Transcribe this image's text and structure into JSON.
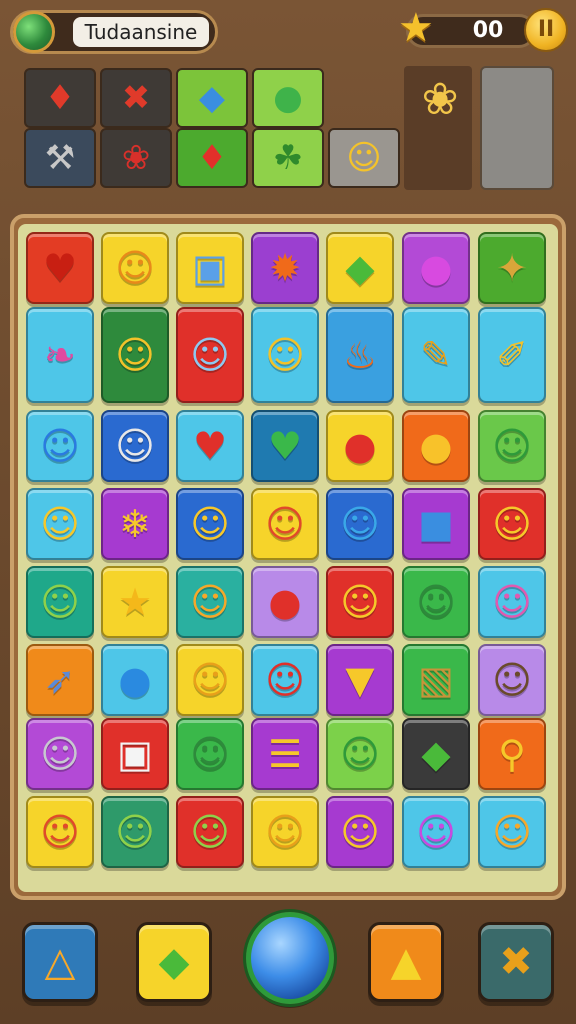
{
  "header": {
    "title": "Tudaansine",
    "score": "00",
    "pause_symbol": "II",
    "star_icon": "star-icon",
    "globe_icon": "globe-icon"
  },
  "collection": [
    {
      "icon": "red-gem-icon",
      "glyph": "♦",
      "bg": "#3f3a36",
      "fg": "#e03a2a"
    },
    {
      "icon": "red-cross-icon",
      "glyph": "✖",
      "bg": "#3f3a36",
      "fg": "#e03a2a"
    },
    {
      "icon": "blue-bird-icon",
      "glyph": "◆",
      "bg": "#7cc43a",
      "fg": "#3a8ee0"
    },
    {
      "icon": "green-creature-icon",
      "glyph": "●",
      "bg": "#8fd14a",
      "fg": "#3fb34a"
    },
    {
      "icon": "wrench-icon",
      "glyph": "⚒",
      "bg": "#3b4a5c",
      "fg": "#c8c8c8"
    },
    {
      "icon": "red-knot-icon",
      "glyph": "❀",
      "bg": "#3f3a36",
      "fg": "#d8302a"
    },
    {
      "icon": "red-diamond-icon",
      "glyph": "♦",
      "bg": "#4caa2e",
      "fg": "#e3302a"
    },
    {
      "icon": "green-dragon-icon",
      "glyph": "☘",
      "bg": "#8fd14a",
      "fg": "#2f8a2c"
    },
    {
      "icon": "yellow-chick-icon",
      "glyph": "☺",
      "bg": "#9a9690",
      "fg": "#f4c32a"
    }
  ],
  "side_icon": "flower-icon",
  "side_glyph": "❀",
  "tiles": [
    {
      "icon": "apple-icon",
      "glyph": "♥",
      "bg": "#e33c24",
      "fg": "#c81f12"
    },
    {
      "icon": "cat-face-icon",
      "glyph": "☺",
      "bg": "#f6d42a",
      "fg": "#e88a1a"
    },
    {
      "icon": "robot-face-icon",
      "glyph": "▣",
      "bg": "#f6d42a",
      "fg": "#5aa0e8"
    },
    {
      "icon": "sun-creature-icon",
      "glyph": "✹",
      "bg": "#9b3fd0",
      "fg": "#f06a1a"
    },
    {
      "icon": "green-leaf-icon",
      "glyph": "◆",
      "bg": "#f6d42a",
      "fg": "#4aba3a"
    },
    {
      "icon": "purple-radish-icon",
      "glyph": "●",
      "bg": "#b34ad6",
      "fg": "#d84ae0"
    },
    {
      "icon": "spinning-top-icon",
      "glyph": "✦",
      "bg": "#4caa2e",
      "fg": "#d8a63a"
    },
    {
      "icon": "rainbow-feather-icon",
      "glyph": "❧",
      "bg": "#4ec6e8",
      "fg": "#e04aa0"
    },
    {
      "icon": "green-figure-icon",
      "glyph": "☺",
      "bg": "#2e8a3c",
      "fg": "#f2c22a"
    },
    {
      "icon": "blue-cat-icon",
      "glyph": "☺",
      "bg": "#e0302a",
      "fg": "#8ec8f0"
    },
    {
      "icon": "yellow-figure-icon",
      "glyph": "☺",
      "bg": "#4ec6e8",
      "fg": "#f2c22a"
    },
    {
      "icon": "flame-icon",
      "glyph": "♨",
      "bg": "#3aa0e0",
      "fg": "#f06a1a"
    },
    {
      "icon": "crayon-icon",
      "glyph": "✎",
      "bg": "#4ec6e8",
      "fg": "#e8a01a"
    },
    {
      "icon": "paint-jar-icon",
      "glyph": "✐",
      "bg": "#4ec6e8",
      "fg": "#f2c22a"
    },
    {
      "icon": "blue-blob-icon",
      "glyph": "☺",
      "bg": "#4ec6e8",
      "fg": "#2a7ae0"
    },
    {
      "icon": "grey-cat-icon",
      "glyph": "☺",
      "bg": "#2a6ad0",
      "fg": "#e8e8e8"
    },
    {
      "icon": "red-heart-icon",
      "glyph": "♥",
      "bg": "#4ec6e8",
      "fg": "#e0302a"
    },
    {
      "icon": "green-heart-icon",
      "glyph": "♥",
      "bg": "#1f7ab0",
      "fg": "#3ab84a"
    },
    {
      "icon": "red-balloon-icon",
      "glyph": "●",
      "bg": "#f6d42a",
      "fg": "#e0302a"
    },
    {
      "icon": "yellow-fruit-icon",
      "glyph": "●",
      "bg": "#f06a1a",
      "fg": "#f8c22a"
    },
    {
      "icon": "green-smiley-icon",
      "glyph": "☺",
      "bg": "#6ac84a",
      "fg": "#2e9a3a"
    },
    {
      "icon": "pink-bow-face-icon",
      "glyph": "☺",
      "bg": "#4ec6e8",
      "fg": "#f6c82a"
    },
    {
      "icon": "ice-cream-icon",
      "glyph": "❄",
      "bg": "#a63ad0",
      "fg": "#f6c82a"
    },
    {
      "icon": "yellow-ghost-icon",
      "glyph": "☺",
      "bg": "#2a6ad0",
      "fg": "#f6c82a"
    },
    {
      "icon": "red-cat-icon",
      "glyph": "☺",
      "bg": "#f6d42a",
      "fg": "#e04a2a"
    },
    {
      "icon": "blue-cat-face-icon",
      "glyph": "☺",
      "bg": "#2a6ad0",
      "fg": "#3aa8e8"
    },
    {
      "icon": "blue-backpack-icon",
      "glyph": "■",
      "bg": "#a63ad0",
      "fg": "#3a8ee0"
    },
    {
      "icon": "fire-creature-icon",
      "glyph": "☺",
      "bg": "#e0302a",
      "fg": "#f6c82a"
    },
    {
      "icon": "green-frog-icon",
      "glyph": "☺",
      "bg": "#1fa88a",
      "fg": "#8fd14a"
    },
    {
      "icon": "gold-star-icon",
      "glyph": "★",
      "bg": "#f6d42a",
      "fg": "#f4b81a"
    },
    {
      "icon": "orange-cat-icon",
      "glyph": "☺",
      "bg": "#2ab0a0",
      "fg": "#f6a82a"
    },
    {
      "icon": "red-tomato-icon",
      "glyph": "●",
      "bg": "#b88ae8",
      "fg": "#e0302a"
    },
    {
      "icon": "yellow-chick-icon",
      "glyph": "☺",
      "bg": "#e0302a",
      "fg": "#f6c82a"
    },
    {
      "icon": "green-goblin-icon",
      "glyph": "☺",
      "bg": "#3ab84a",
      "fg": "#2e8a3c"
    },
    {
      "icon": "pink-pig-icon",
      "glyph": "☺",
      "bg": "#4ec6e8",
      "fg": "#e05ab0"
    },
    {
      "icon": "rocket-icon",
      "glyph": "➶",
      "bg": "#f08a1a",
      "fg": "#5a8ad8"
    },
    {
      "icon": "blue-unicorn-icon",
      "glyph": "●",
      "bg": "#4ec6e8",
      "fg": "#2a8ae0"
    },
    {
      "icon": "yellow-dog-icon",
      "glyph": "☺",
      "bg": "#f6d42a",
      "fg": "#e8a01a"
    },
    {
      "icon": "red-berry-icon",
      "glyph": "☺",
      "bg": "#4ec6e8",
      "fg": "#e0302a"
    },
    {
      "icon": "cheese-icon",
      "glyph": "▼",
      "bg": "#a63ad0",
      "fg": "#f6c82a"
    },
    {
      "icon": "toast-icon",
      "glyph": "▧",
      "bg": "#3ab84a",
      "fg": "#c8943a"
    },
    {
      "icon": "owl-face-icon",
      "glyph": "☺",
      "bg": "#b88ae8",
      "fg": "#6a4a2a"
    },
    {
      "icon": "grey-cat-face-icon",
      "glyph": "☺",
      "bg": "#b34ad6",
      "fg": "#c8c8d0"
    },
    {
      "icon": "gift-box-icon",
      "glyph": "▣",
      "bg": "#e0302a",
      "fg": "#f4f4f4"
    },
    {
      "icon": "green-snail-icon",
      "glyph": "☺",
      "bg": "#3ab84a",
      "fg": "#2e8a3c"
    },
    {
      "icon": "book-stack-icon",
      "glyph": "☰",
      "bg": "#a63ad0",
      "fg": "#f6c82a"
    },
    {
      "icon": "green-snake-icon",
      "glyph": "☺",
      "bg": "#7cd14a",
      "fg": "#2e9a3a"
    },
    {
      "icon": "green-leaf-dark-icon",
      "glyph": "◆",
      "bg": "#3a3a3a",
      "fg": "#4aba3a"
    },
    {
      "icon": "magnifier-icon",
      "glyph": "⚲",
      "bg": "#f06a1a",
      "fg": "#f6c82a"
    },
    {
      "icon": "red-spiky-face-icon",
      "glyph": "☺",
      "bg": "#f6d42a",
      "fg": "#e04a2a"
    },
    {
      "icon": "green-monster-icon",
      "glyph": "☺",
      "bg": "#2e9a6a",
      "fg": "#8fd14a"
    },
    {
      "icon": "green-apple-face-icon",
      "glyph": "☺",
      "bg": "#e0302a",
      "fg": "#8fd14a"
    },
    {
      "icon": "red-hair-face-icon",
      "glyph": "☺",
      "bg": "#f6d42a",
      "fg": "#e8a01a"
    },
    {
      "icon": "orange-cat-face-icon",
      "glyph": "☺",
      "bg": "#a63ad0",
      "fg": "#f6c82a"
    },
    {
      "icon": "purple-flame-icon",
      "glyph": "☺",
      "bg": "#4ec6e8",
      "fg": "#c84ae0"
    },
    {
      "icon": "orange-sun-face-icon",
      "glyph": "☺",
      "bg": "#4ec6e8",
      "fg": "#f6a82a"
    }
  ],
  "toolbar": [
    {
      "icon": "triangle-tool-icon",
      "glyph": "△",
      "bg": "#2f7ab8",
      "fg": "#f6a82a"
    },
    {
      "icon": "green-leaf-tool-icon",
      "glyph": "◆",
      "bg": "#f6d42a",
      "fg": "#4aba3a"
    },
    {
      "icon": "blue-orb-icon",
      "glyph": "",
      "bg": "#3d8de8",
      "fg": "#ffffff"
    },
    {
      "icon": "gold-cup-icon",
      "glyph": "▲",
      "bg": "#f08a1a",
      "fg": "#f6d42a"
    },
    {
      "icon": "cross-tool-icon",
      "glyph": "✖",
      "bg": "#3a6a6a",
      "fg": "#e8a01a"
    }
  ]
}
